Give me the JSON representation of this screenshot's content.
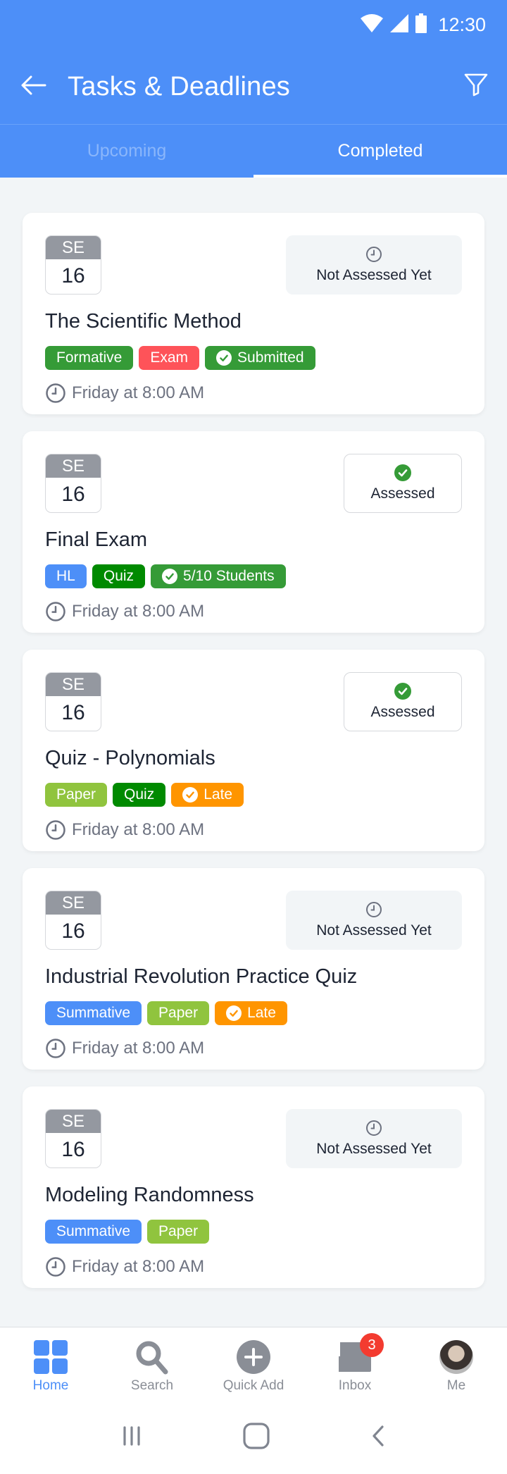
{
  "status_bar": {
    "time": "12:30",
    "icons": [
      "wifi-icon",
      "signal-icon",
      "battery-icon"
    ]
  },
  "app_bar": {
    "title": "Tasks & Deadlines",
    "back_icon": "arrow-left-icon",
    "filter_icon": "filter-icon"
  },
  "tabs": [
    {
      "label": "Upcoming",
      "active": false
    },
    {
      "label": "Completed",
      "active": true
    }
  ],
  "colors": {
    "primary": "#4d8ff8",
    "green": "#359b37",
    "dark_green": "#008a00",
    "red": "#fe5359",
    "orange": "#ff9500",
    "lime": "#90c43e",
    "blue": "#4d8ff8",
    "badge_red": "#f33b30"
  },
  "tasks": [
    {
      "month": "SE",
      "day": "16",
      "title": "The Scientific Method",
      "status": "Not Assessed Yet",
      "assessed": false,
      "tags": [
        {
          "label": "Formative",
          "color": "#359b37",
          "check": false
        },
        {
          "label": "Exam",
          "color": "#fe5359",
          "check": false
        },
        {
          "label": "Submitted",
          "color": "#359b37",
          "check": true
        }
      ],
      "due": "Friday at 8:00 AM"
    },
    {
      "month": "SE",
      "day": "16",
      "title": "Final Exam",
      "status": "Assessed",
      "assessed": true,
      "tags": [
        {
          "label": "HL",
          "color": "#4d8ff8",
          "check": false
        },
        {
          "label": "Quiz",
          "color": "#008a00",
          "check": false
        },
        {
          "label": "5/10 Students",
          "color": "#359b37",
          "check": true
        }
      ],
      "due": "Friday at 8:00 AM"
    },
    {
      "month": "SE",
      "day": "16",
      "title": "Quiz - Polynomials",
      "status": "Assessed",
      "assessed": true,
      "tags": [
        {
          "label": "Paper",
          "color": "#90c43e",
          "check": false
        },
        {
          "label": "Quiz",
          "color": "#008a00",
          "check": false
        },
        {
          "label": "Late",
          "color": "#ff9500",
          "check": true
        }
      ],
      "due": "Friday at 8:00 AM"
    },
    {
      "month": "SE",
      "day": "16",
      "title": "Industrial Revolution Practice Quiz",
      "status": "Not Assessed Yet",
      "assessed": false,
      "tags": [
        {
          "label": "Summative",
          "color": "#4d8ff8",
          "check": false
        },
        {
          "label": "Paper",
          "color": "#90c43e",
          "check": false
        },
        {
          "label": "Late",
          "color": "#ff9500",
          "check": true
        }
      ],
      "due": "Friday at 8:00 AM"
    },
    {
      "month": "SE",
      "day": "16",
      "title": "Modeling Randomness",
      "status": "Not Assessed Yet",
      "assessed": false,
      "tags": [
        {
          "label": "Summative",
          "color": "#4d8ff8",
          "check": false
        },
        {
          "label": "Paper",
          "color": "#90c43e",
          "check": false
        }
      ],
      "due": "Friday at 8:00 AM"
    }
  ],
  "bottom_nav": [
    {
      "label": "Home",
      "icon": "home-grid-icon",
      "active": true
    },
    {
      "label": "Search",
      "icon": "search-icon",
      "active": false
    },
    {
      "label": "Quick Add",
      "icon": "plus-circle-icon",
      "active": false
    },
    {
      "label": "Inbox",
      "icon": "inbox-icon",
      "active": false,
      "badge": "3"
    },
    {
      "label": "Me",
      "icon": "avatar",
      "active": false
    }
  ],
  "system_nav": [
    "recents-icon",
    "home-icon",
    "back-icon"
  ]
}
